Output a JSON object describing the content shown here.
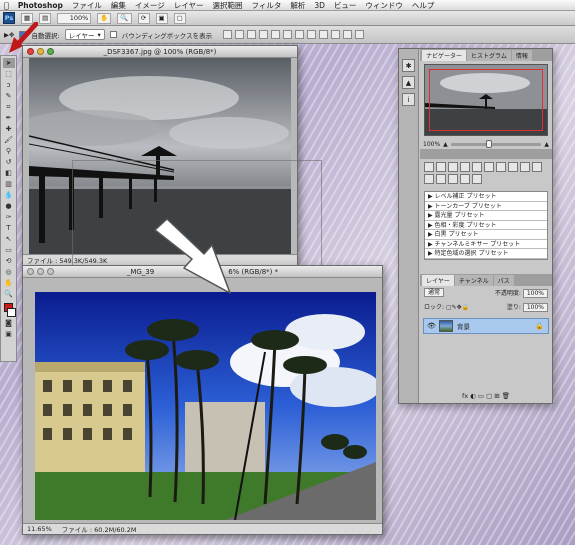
{
  "menubar": {
    "apple": "",
    "app_name": "Photoshop",
    "items": [
      "ファイル",
      "編集",
      "イメージ",
      "レイヤー",
      "選択範囲",
      "フィルタ",
      "解析",
      "3D",
      "ビュー",
      "ウィンドウ",
      "ヘルプ"
    ]
  },
  "appbar": {
    "logo": "Ps",
    "zoom": "100%"
  },
  "options": {
    "auto_select_label": "自動選択:",
    "auto_select_value": "レイヤー",
    "bounding_box_label": "バウンディングボックスを表示"
  },
  "doc1": {
    "title": "_DSF3367.jpg @ 100% (RGB/8*)",
    "status_file": "ファイル : 549.3K/549.3K"
  },
  "doc2": {
    "title": "_MG_39",
    "title_tail": "6% (RGB/8*) *",
    "zoom": "11.65%",
    "status_file": "ファイル : 60.2M/60.2M"
  },
  "navigator": {
    "tabs": [
      "ナビゲーター",
      "ヒストグラム",
      "情報"
    ],
    "zoom": "100%",
    "zoom_level": 0.42
  },
  "adjustments": {
    "presets": [
      "レベル補正 プリセット",
      "トーンカーブ プリセット",
      "露光量 プリセット",
      "色相・彩度 プリセット",
      "白黒 プリセット",
      "チャンネルミキサー プリセット",
      "特定色域の選択 プリセット"
    ]
  },
  "layers": {
    "tabs": [
      "レイヤー",
      "チャンネル",
      "パス"
    ],
    "blend_mode": "通常",
    "opacity_label": "不透明度:",
    "opacity": "100%",
    "lock_label": "ロック:",
    "fill_label": "塗り:",
    "fill": "100%",
    "layer_name": "背景",
    "footer_icons": "fx ◐ ▭ ▢ ⊞ 🗑"
  },
  "colors": {
    "foreground": "#d01a1a",
    "background": "#ffffff",
    "accent": "#a9c8ee"
  }
}
